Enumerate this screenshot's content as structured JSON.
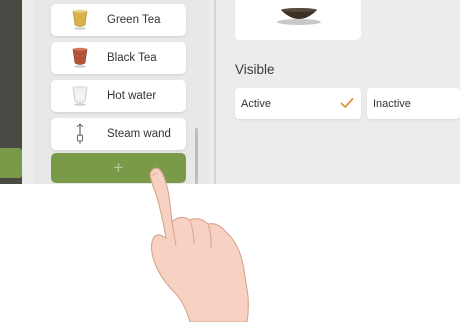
{
  "sidebar": {
    "items": [
      {
        "label": "Green Tea",
        "icon": "green-tea-cup-icon"
      },
      {
        "label": "Black Tea",
        "icon": "black-tea-cup-icon"
      },
      {
        "label": "Hot water",
        "icon": "hot-water-cup-icon"
      },
      {
        "label": "Steam wand",
        "icon": "steam-wand-icon"
      }
    ],
    "add_button": {
      "label": "+"
    }
  },
  "detail": {
    "visibility_title": "Visible",
    "options": [
      {
        "label": "Active",
        "selected": true
      },
      {
        "label": "Inactive",
        "selected": false
      }
    ]
  },
  "colors": {
    "accent_green": "#7a9a4a",
    "check_orange": "#d9963a",
    "rail_dark": "#4a4943"
  }
}
